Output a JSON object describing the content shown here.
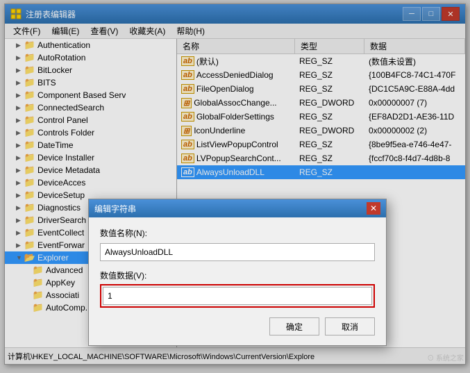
{
  "window": {
    "title": "注册表编辑器",
    "icon": "🗂️"
  },
  "titleControls": {
    "minimize": "─",
    "restore": "□",
    "close": "✕"
  },
  "menuBar": {
    "items": [
      {
        "label": "文件(F)"
      },
      {
        "label": "编辑(E)"
      },
      {
        "label": "查看(V)"
      },
      {
        "label": "收藏夹(A)"
      },
      {
        "label": "帮助(H)"
      }
    ]
  },
  "treePanel": {
    "items": [
      {
        "label": "Authentication",
        "indent": 1,
        "expanded": false
      },
      {
        "label": "AutoRotation",
        "indent": 1,
        "expanded": false
      },
      {
        "label": "BitLocker",
        "indent": 1,
        "expanded": false
      },
      {
        "label": "BITS",
        "indent": 1,
        "expanded": false
      },
      {
        "label": "Component Based Serv",
        "indent": 1,
        "expanded": false
      },
      {
        "label": "ConnectedSearch",
        "indent": 1,
        "expanded": false
      },
      {
        "label": "Control Panel",
        "indent": 1,
        "expanded": false
      },
      {
        "label": "Controls Folder",
        "indent": 1,
        "expanded": false
      },
      {
        "label": "DateTime",
        "indent": 1,
        "expanded": false
      },
      {
        "label": "Device Installer",
        "indent": 1,
        "expanded": false
      },
      {
        "label": "Device Metadata",
        "indent": 1,
        "expanded": false
      },
      {
        "label": "DeviceAcces",
        "indent": 1,
        "expanded": false
      },
      {
        "label": "DeviceSetup",
        "indent": 1,
        "expanded": false
      },
      {
        "label": "Diagnostics",
        "indent": 1,
        "expanded": false
      },
      {
        "label": "DriverSearch",
        "indent": 1,
        "expanded": false
      },
      {
        "label": "EventCollect",
        "indent": 1,
        "expanded": false
      },
      {
        "label": "EventForwar",
        "indent": 1,
        "expanded": false
      },
      {
        "label": "Explorer",
        "indent": 1,
        "expanded": true,
        "selected": false
      },
      {
        "label": "Advanced",
        "indent": 2,
        "expanded": false
      },
      {
        "label": "AppKey",
        "indent": 2,
        "expanded": false
      },
      {
        "label": "Associati",
        "indent": 2,
        "expanded": false
      },
      {
        "label": "AutoComp...",
        "indent": 2,
        "expanded": false
      }
    ]
  },
  "listPanel": {
    "columns": [
      {
        "label": "名称",
        "key": "name"
      },
      {
        "label": "类型",
        "key": "type"
      },
      {
        "label": "数据",
        "key": "data"
      }
    ],
    "rows": [
      {
        "name": "(默认)",
        "type": "REG_SZ",
        "data": "(数值未设置)",
        "icon": "ab"
      },
      {
        "name": "AccessDeniedDialog",
        "type": "REG_SZ",
        "data": "{100B4FC8-74C1-470F",
        "icon": "ab"
      },
      {
        "name": "FileOpenDialog",
        "type": "REG_SZ",
        "data": "{DC1C5A9C-E88A-4dd",
        "icon": "ab"
      },
      {
        "name": "GlobalAssocChange...",
        "type": "REG_DWORD",
        "data": "0x00000007 (7)",
        "icon": "⊞"
      },
      {
        "name": "GlobalFolderSettings",
        "type": "REG_SZ",
        "data": "{EF8AD2D1-AE36-11D",
        "icon": "ab"
      },
      {
        "name": "IconUnderline",
        "type": "REG_DWORD",
        "data": "0x00000002 (2)",
        "icon": "⊞"
      },
      {
        "name": "ListViewPopupControl",
        "type": "REG_SZ",
        "data": "{8be9f5ea-e746-4e47-",
        "icon": "ab"
      },
      {
        "name": "LVPopupSearchCont...",
        "type": "REG_SZ",
        "data": "{fccf70c8-f4d7-4d8b-8",
        "icon": "ab"
      },
      {
        "name": "AlwaysUnloadDLL",
        "type": "REG_SZ",
        "data": "",
        "icon": "ab",
        "selected": true
      }
    ]
  },
  "dialog": {
    "title": "编辑字符串",
    "nameLabel": "数值名称(N):",
    "nameValue": "AlwaysUnloadDLL",
    "dataLabel": "数值数据(V):",
    "dataValue": "1",
    "confirmBtn": "确定",
    "cancelBtn": "取消"
  },
  "statusBar": {
    "text": "计算机\\HKEY_LOCAL_MACHINE\\SOFTWARE\\Microsoft\\Windows\\CurrentVersion\\Explore"
  },
  "watermark": {
    "text": "⊙ 系统之家"
  }
}
